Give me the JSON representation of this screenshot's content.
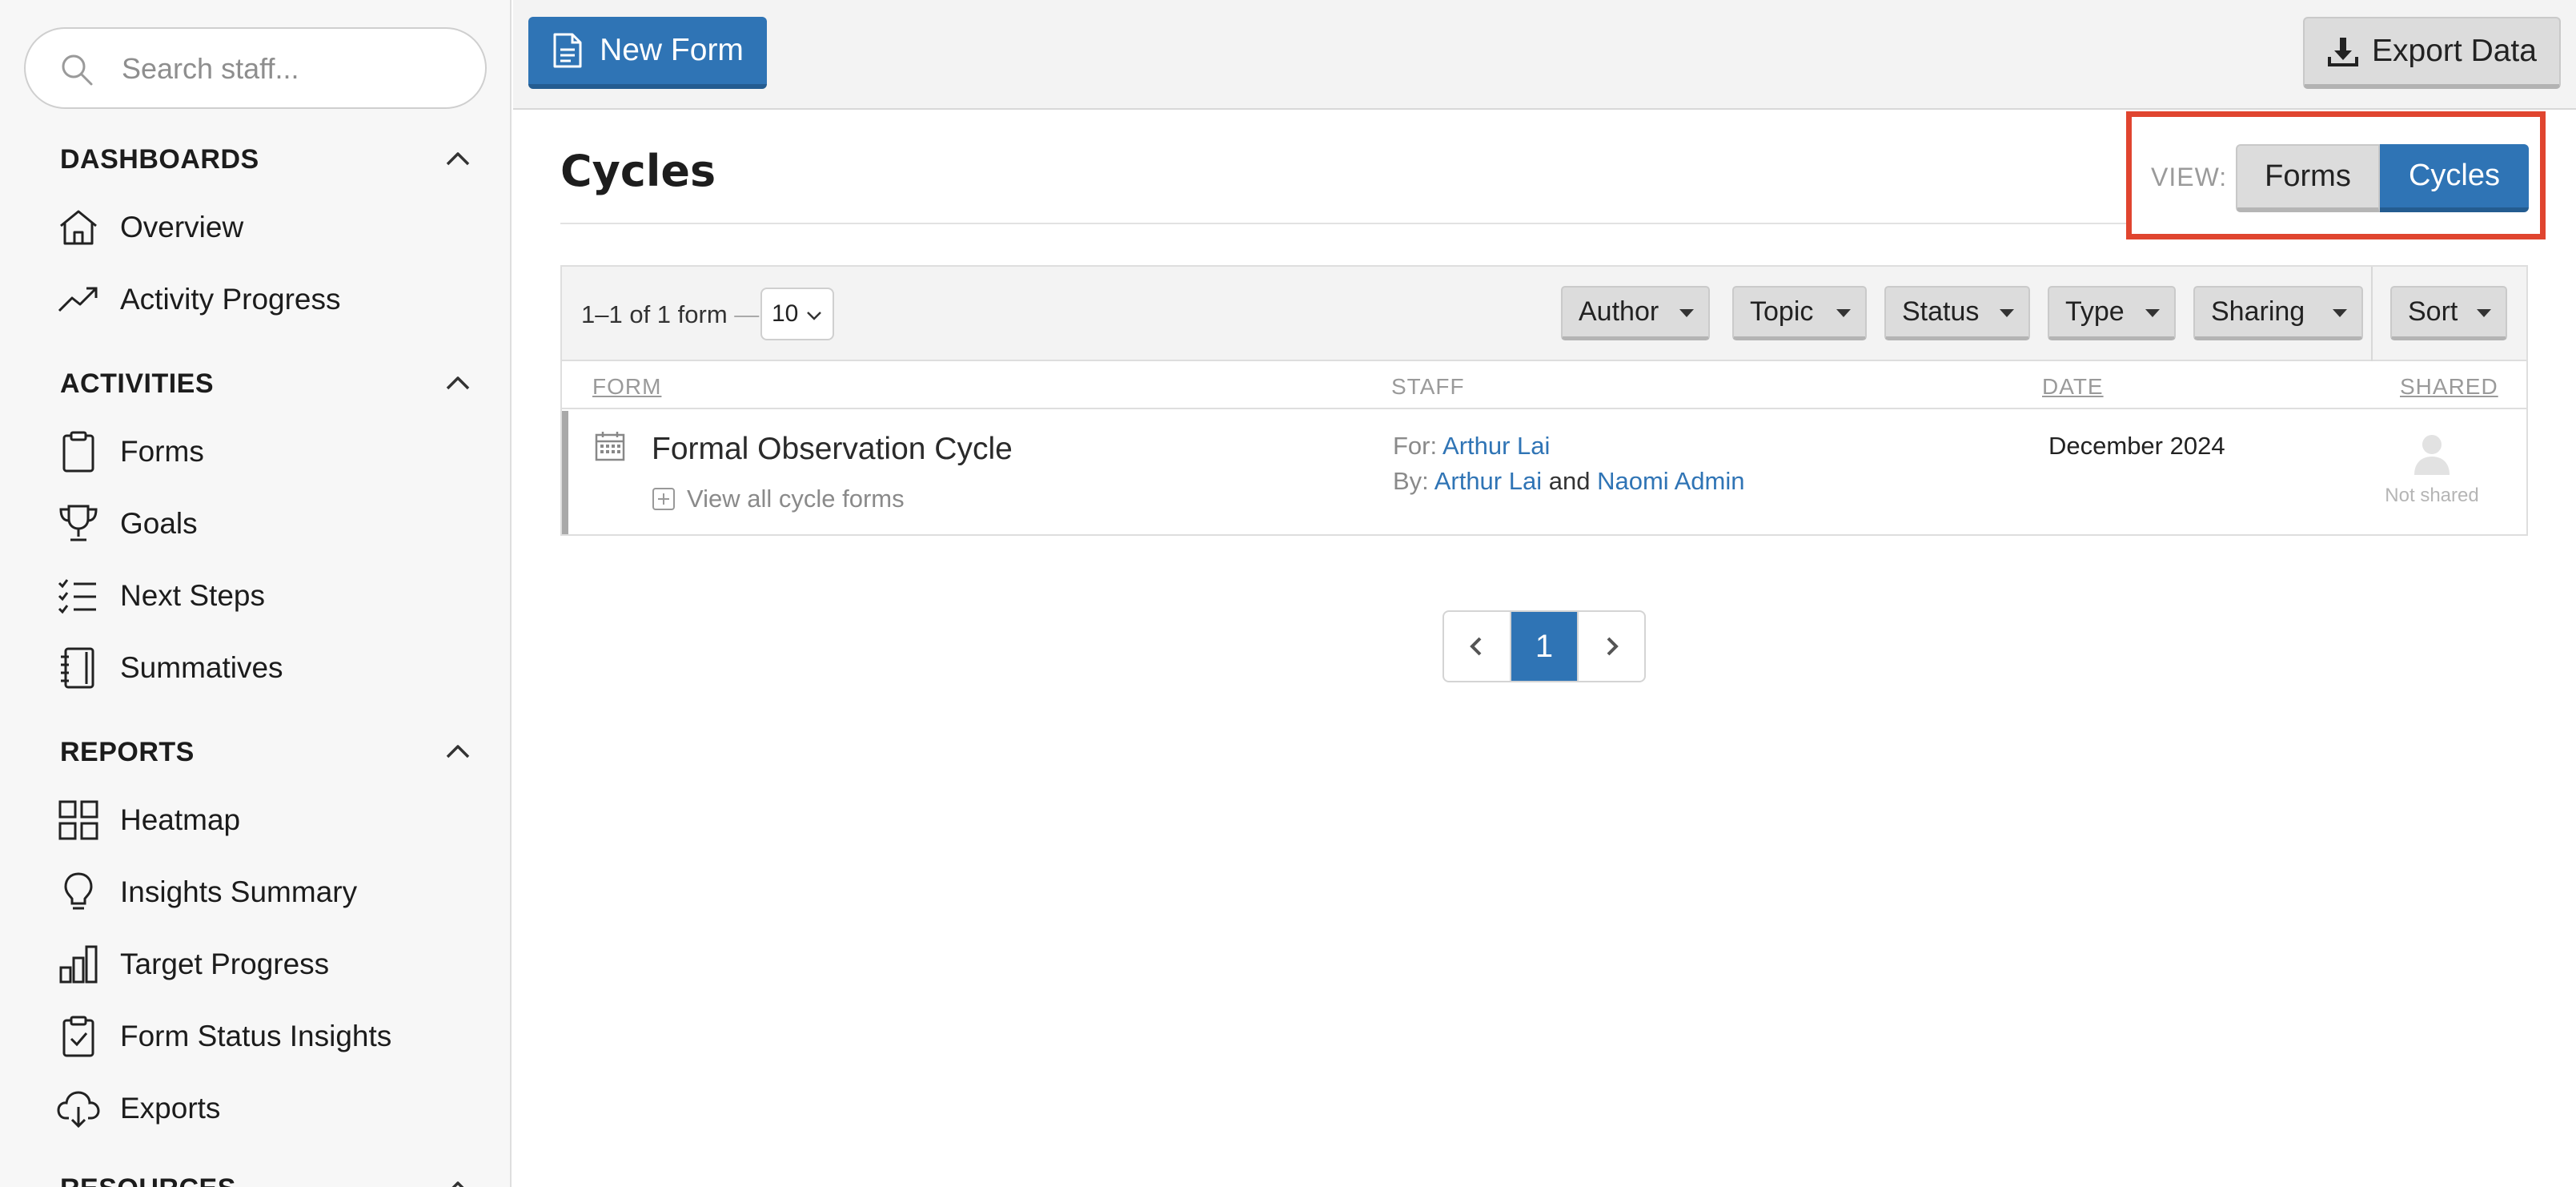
{
  "sidebar": {
    "search_placeholder": "Search staff...",
    "sections": [
      {
        "title": "DASHBOARDS",
        "items": [
          {
            "label": "Overview",
            "icon": "home-icon"
          },
          {
            "label": "Activity Progress",
            "icon": "trend-up-icon"
          }
        ]
      },
      {
        "title": "ACTIVITIES",
        "items": [
          {
            "label": "Forms",
            "icon": "clipboard-icon"
          },
          {
            "label": "Goals",
            "icon": "trophy-icon"
          },
          {
            "label": "Next Steps",
            "icon": "checklist-icon"
          },
          {
            "label": "Summatives",
            "icon": "notebook-icon"
          }
        ]
      },
      {
        "title": "REPORTS",
        "items": [
          {
            "label": "Heatmap",
            "icon": "grid-icon"
          },
          {
            "label": "Insights Summary",
            "icon": "lightbulb-icon"
          },
          {
            "label": "Target Progress",
            "icon": "bar-chart-icon"
          },
          {
            "label": "Form Status Insights",
            "icon": "clipboard-check-icon"
          },
          {
            "label": "Exports",
            "icon": "cloud-download-icon"
          }
        ]
      },
      {
        "title": "RESOURCES",
        "items": []
      }
    ]
  },
  "toolbar": {
    "new_form_label": "New Form",
    "export_label": "Export Data"
  },
  "main": {
    "title": "Cycles",
    "view": {
      "label": "VIEW:",
      "options": [
        "Forms",
        "Cycles"
      ],
      "selected": "Cycles"
    },
    "count_text": "1–1 of 1 form",
    "count_dash": "—",
    "per_page": "10",
    "filters": [
      "Author",
      "Topic",
      "Status",
      "Type",
      "Sharing"
    ],
    "sort_label": "Sort",
    "columns": {
      "form": "FORM",
      "staff": "STAFF",
      "date": "DATE",
      "shared": "SHARED"
    },
    "rows": [
      {
        "name": "Formal Observation Cycle",
        "view_all": "View all cycle forms",
        "for_prefix": "For:",
        "for_staff": "Arthur Lai",
        "by_prefix": "By:",
        "by_staff_1": "Arthur Lai",
        "by_joiner": "and",
        "by_staff_2": "Naomi Admin",
        "date": "December 2024",
        "shared": "Not shared"
      }
    ]
  },
  "pagination": {
    "current_page": "1"
  },
  "colors": {
    "accent": "#2f74b5",
    "highlight_box": "#e0452f",
    "sidebar_bg": "#f7f7f7",
    "topbar_bg": "#f3f3f3"
  }
}
